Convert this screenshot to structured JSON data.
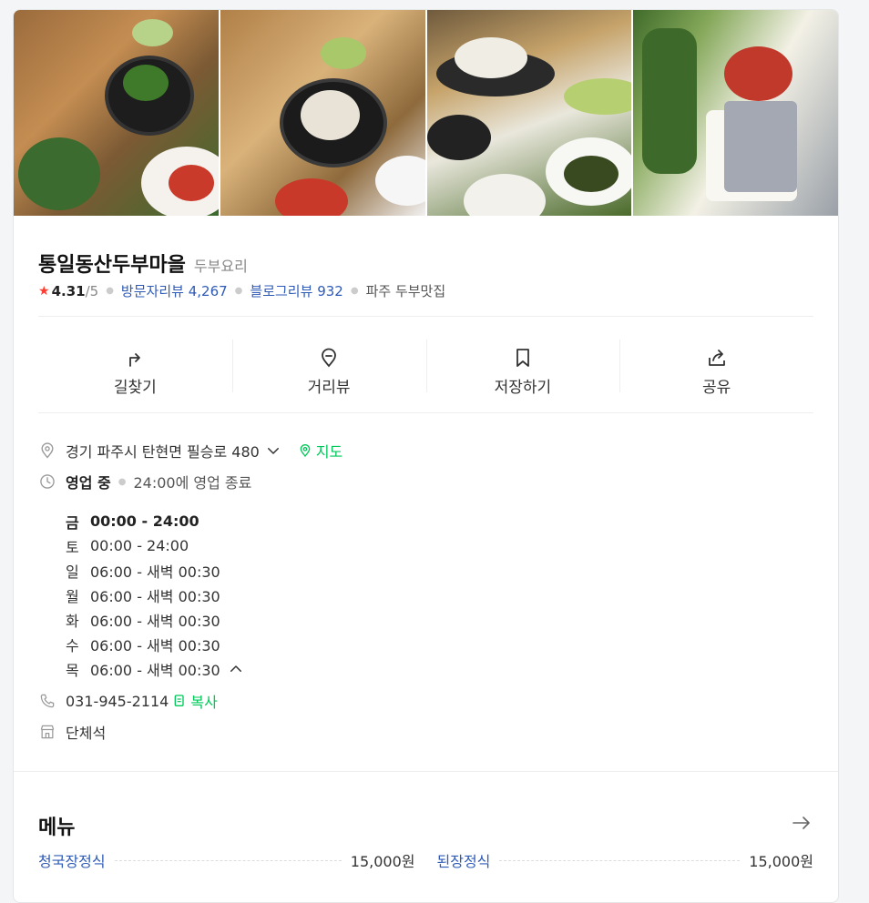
{
  "place": {
    "name": "통일동산두부마을",
    "category": "두부요리",
    "rating": "4.31",
    "rating_max": "/5",
    "visit_review_label": "방문자리뷰",
    "visit_review_count": "4,267",
    "blog_review_label": "블로그리뷰",
    "blog_review_count": "932",
    "tag": "파주 두부맛집"
  },
  "actions": [
    {
      "label": "길찾기",
      "icon": "directions-icon"
    },
    {
      "label": "거리뷰",
      "icon": "street-view-pin-icon"
    },
    {
      "label": "저장하기",
      "icon": "bookmark-icon"
    },
    {
      "label": "공유",
      "icon": "share-icon"
    }
  ],
  "address": {
    "text": "경기 파주시 탄현면 필승로 480",
    "map_label": "지도"
  },
  "business": {
    "status": "영업 중",
    "note": "24:00에 영업 종료",
    "hours": [
      {
        "day": "금",
        "time": "00:00 - 24:00"
      },
      {
        "day": "토",
        "time": "00:00 - 24:00"
      },
      {
        "day": "일",
        "time": "06:00 - 새벽 00:30"
      },
      {
        "day": "월",
        "time": "06:00 - 새벽 00:30"
      },
      {
        "day": "화",
        "time": "06:00 - 새벽 00:30"
      },
      {
        "day": "수",
        "time": "06:00 - 새벽 00:30"
      },
      {
        "day": "목",
        "time": "06:00 - 새벽 00:30"
      }
    ]
  },
  "phone": {
    "number": "031-945-2114",
    "copy_label": "복사"
  },
  "seating": "단체석",
  "menu": {
    "title": "메뉴",
    "items": [
      {
        "name": "청국장정식",
        "price": "15,000원"
      },
      {
        "name": "된장정식",
        "price": "15,000원"
      }
    ]
  },
  "colors": {
    "link": "#2f5bb7",
    "accent_green": "#03c75a",
    "star": "#ff3b30"
  }
}
